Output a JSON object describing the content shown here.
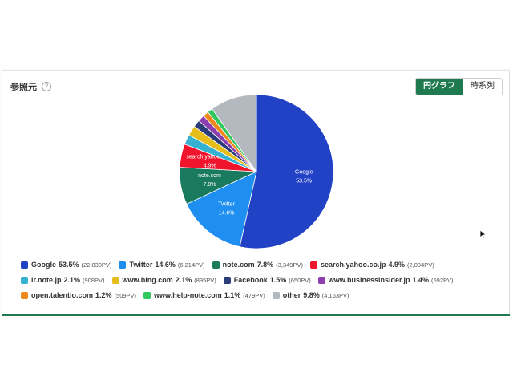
{
  "card": {
    "title": "参照元",
    "help_icon": "question-circle-icon",
    "toggle": {
      "pie_label": "円グラフ",
      "timeseries_label": "時系列",
      "active": "pie"
    }
  },
  "chart_data": {
    "type": "pie",
    "slices": [
      {
        "label": "Google",
        "pct": "53.5%",
        "pct_value": 53.5,
        "pv": "(22,830PV)",
        "color": "#2242c6"
      },
      {
        "label": "Twitter",
        "pct": "14.6%",
        "pct_value": 14.6,
        "pv": "(6,214PV)",
        "color": "#1f8ef1"
      },
      {
        "label": "note.com",
        "pct": "7.8%",
        "pct_value": 7.8,
        "pv": "(3,349PV)",
        "color": "#1a7a5e"
      },
      {
        "label": "search.yahoo.co.jp",
        "pct": "4.9%",
        "pct_value": 4.9,
        "pv": "(2,094PV)",
        "color": "#f0142c"
      },
      {
        "label": "ir.note.jp",
        "pct": "2.1%",
        "pct_value": 2.1,
        "pv": "(908PV)",
        "color": "#37b1d1"
      },
      {
        "label": "www.bing.com",
        "pct": "2.1%",
        "pct_value": 2.1,
        "pv": "(895PV)",
        "color": "#e6bd1a"
      },
      {
        "label": "Facebook",
        "pct": "1.5%",
        "pct_value": 1.5,
        "pv": "(650PV)",
        "color": "#2b3c7a"
      },
      {
        "label": "www.businessinsider.jp",
        "pct": "1.4%",
        "pct_value": 1.4,
        "pv": "(592PV)",
        "color": "#8d3fb0"
      },
      {
        "label": "open.talentio.com",
        "pct": "1.2%",
        "pct_value": 1.2,
        "pv": "(509PV)",
        "color": "#ee8a1d"
      },
      {
        "label": "www.help-note.com",
        "pct": "1.1%",
        "pct_value": 1.1,
        "pv": "(479PV)",
        "color": "#31c85f"
      },
      {
        "label": "other",
        "pct": "9.8%",
        "pct_value": 9.8,
        "pv": "(4,163PV)",
        "color": "#b3b9bf"
      }
    ],
    "in_slice_labels": [
      "Google",
      "Twitter",
      "note.com",
      "search.yahoo.co.jp"
    ],
    "legend_placement": "bottom"
  }
}
